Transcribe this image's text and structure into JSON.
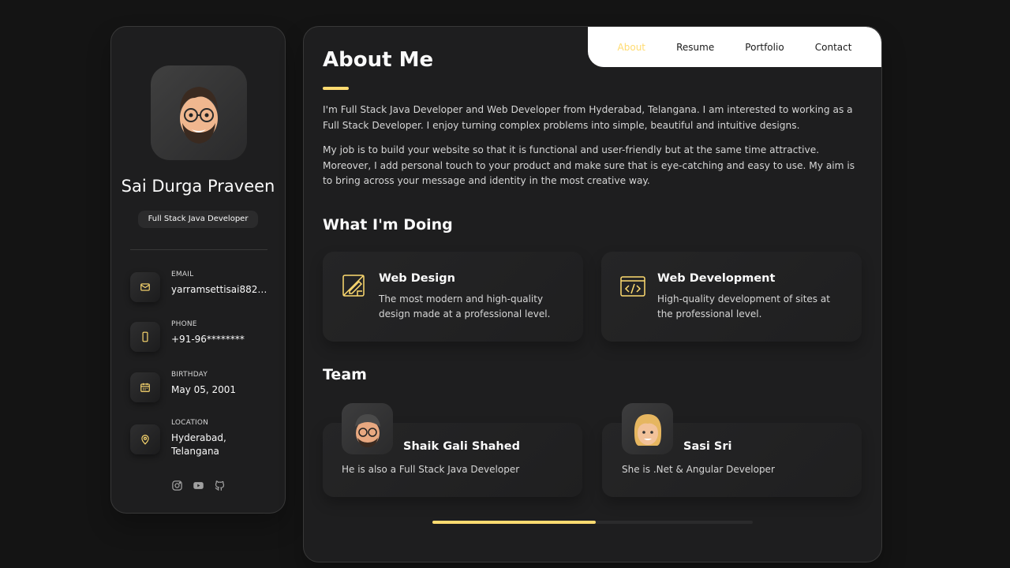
{
  "profile": {
    "name": "Sai Durga Praveen",
    "title": "Full Stack Java Developer",
    "avatar_icon": "memoji-avatar"
  },
  "contacts": [
    {
      "label": "Email",
      "value": "yarramsettisai882@...",
      "icon": "mail-icon"
    },
    {
      "label": "Phone",
      "value": "+91-96********",
      "icon": "phone-icon"
    },
    {
      "label": "Birthday",
      "value": "May 05, 2001",
      "icon": "calendar-icon"
    },
    {
      "label": "Location",
      "value": "Hyderabad, Telangana",
      "icon": "location-icon"
    }
  ],
  "socials": [
    "instagram-icon",
    "youtube-icon",
    "github-icon"
  ],
  "nav": {
    "items": [
      "About",
      "Resume",
      "Portfolio",
      "Contact"
    ],
    "active": "About"
  },
  "about": {
    "heading": "About Me",
    "paragraphs": [
      "I'm Full Stack Java Developer and Web Developer from Hyderabad, Telangana. I am interested to working as a Full Stack Developer. I enjoy turning complex problems into simple, beautiful and intuitive designs.",
      "My job is to build your website so that it is functional and user-friendly but at the same time attractive. Moreover, I add personal touch to your product and make sure that is eye-catching and easy to use. My aim is to bring across your message and identity in the most creative way."
    ]
  },
  "doing": {
    "heading": "What I'm Doing",
    "services": [
      {
        "title": "Web Design",
        "text": "The most modern and high-quality design made at a professional level.",
        "icon": "design-icon"
      },
      {
        "title": "Web Development",
        "text": "High-quality development of sites at the professional level.",
        "icon": "code-window-icon"
      }
    ]
  },
  "team": {
    "heading": "Team",
    "members": [
      {
        "name": "Shaik Gali Shahed",
        "role": "He is also a Full Stack Java Developer"
      },
      {
        "name": "Sasi Sri",
        "role": "She is .Net & Angular Developer"
      }
    ]
  },
  "scroll": {
    "progress": 0.51
  },
  "colors": {
    "accent": "#ffdb70",
    "background": "#141414",
    "card": "#1e1e1f"
  }
}
